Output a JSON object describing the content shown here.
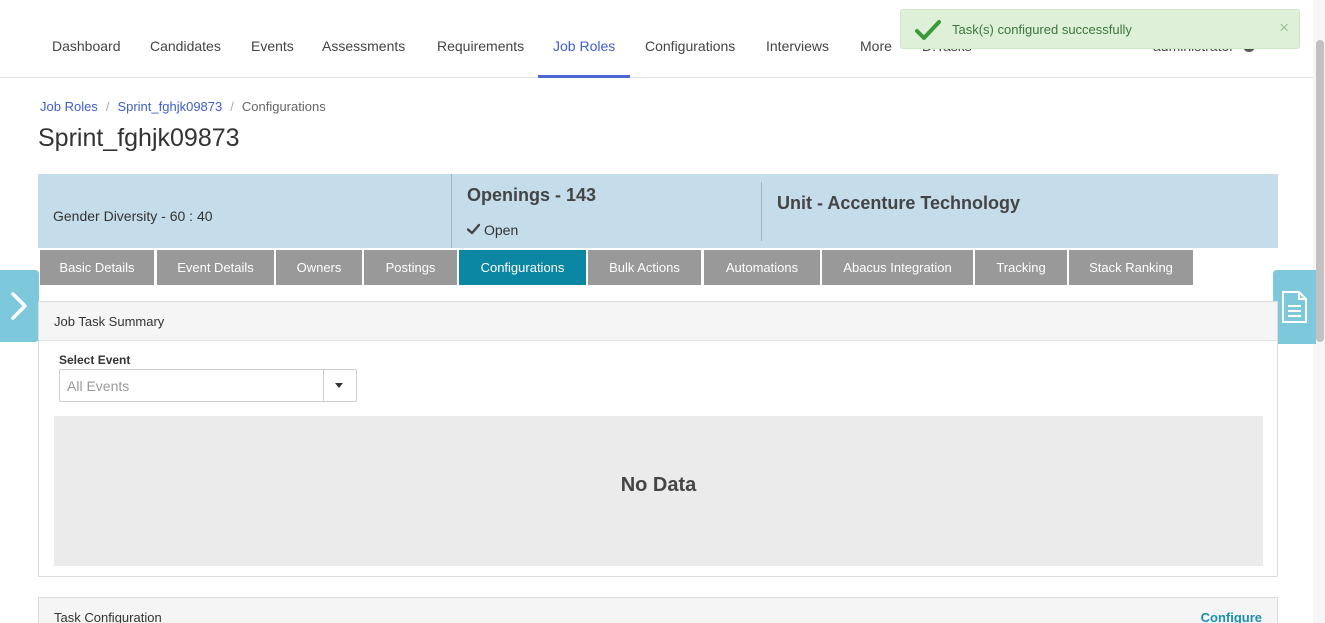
{
  "nav": {
    "items": [
      "Dashboard",
      "Candidates",
      "Events",
      "Assessments",
      "Requirements",
      "Job Roles",
      "Configurations",
      "Interviews",
      "More",
      "D.Tasks"
    ],
    "active": "Job Roles",
    "user": "administrator"
  },
  "toast": {
    "message": "Task(s) configured successfully",
    "close": "×"
  },
  "breadcrumb": {
    "items": [
      "Job Roles",
      "Sprint_fghjk09873",
      "Configurations"
    ],
    "separator": "/"
  },
  "page": {
    "title": "Sprint_fghjk09873"
  },
  "summary": {
    "gender_diversity": "Gender Diversity - 60 : 40",
    "openings": "Openings - 143",
    "status": "Open",
    "unit": "Unit - Accenture Technology"
  },
  "tabs": {
    "items": [
      "Basic Details",
      "Event Details",
      "Owners",
      "Postings",
      "Configurations",
      "Bulk Actions",
      "Automations",
      "Abacus Integration",
      "Tracking",
      "Stack Ranking"
    ],
    "active": "Configurations"
  },
  "job_task_summary": {
    "title": "Job Task Summary",
    "select_label": "Select Event",
    "select_value": "All Events",
    "empty_text": "No Data"
  },
  "task_configuration": {
    "title": "Task Configuration",
    "action": "Configure"
  },
  "colors": {
    "accent": "#3f5ecc",
    "tab_active": "#0b86a3",
    "tab_inactive": "#999999",
    "summary_bg": "#c5dcea",
    "toast_bg": "#dff0d8",
    "toast_text": "#3c763d",
    "side_toggle": "#7ec8dc"
  },
  "icons": {
    "toast": "check-icon",
    "status": "check-icon",
    "left_toggle": "chevron-right-icon",
    "right_toggle": "document-icon",
    "select": "caret-down-icon",
    "user": "user-icon"
  }
}
